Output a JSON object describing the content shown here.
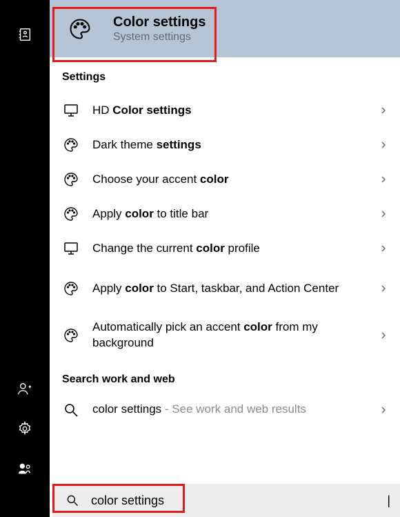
{
  "topResult": {
    "title": "Color settings",
    "sub": "System settings"
  },
  "sections": {
    "settingsHeader": "Settings",
    "webHeader": "Search work and web"
  },
  "results": [
    {
      "icon": "monitor",
      "html": "HD <b>Color settings</b>"
    },
    {
      "icon": "palette",
      "html": "Dark theme <b>settings</b>"
    },
    {
      "icon": "palette",
      "html": "Choose your accent <b>color</b>"
    },
    {
      "icon": "palette",
      "html": "Apply <b>color</b> to title bar"
    },
    {
      "icon": "monitor",
      "html": "Change the current <b>color</b> profile"
    },
    {
      "icon": "palette",
      "html": "Apply <b>color</b> to Start, taskbar, and Action Center"
    },
    {
      "icon": "palette",
      "html": "Automatically pick an accent <b>color</b> from my background"
    }
  ],
  "webResult": {
    "label": "color settings",
    "hint": " - See work and web results"
  },
  "search": {
    "query": "color settings",
    "caret": "|"
  }
}
